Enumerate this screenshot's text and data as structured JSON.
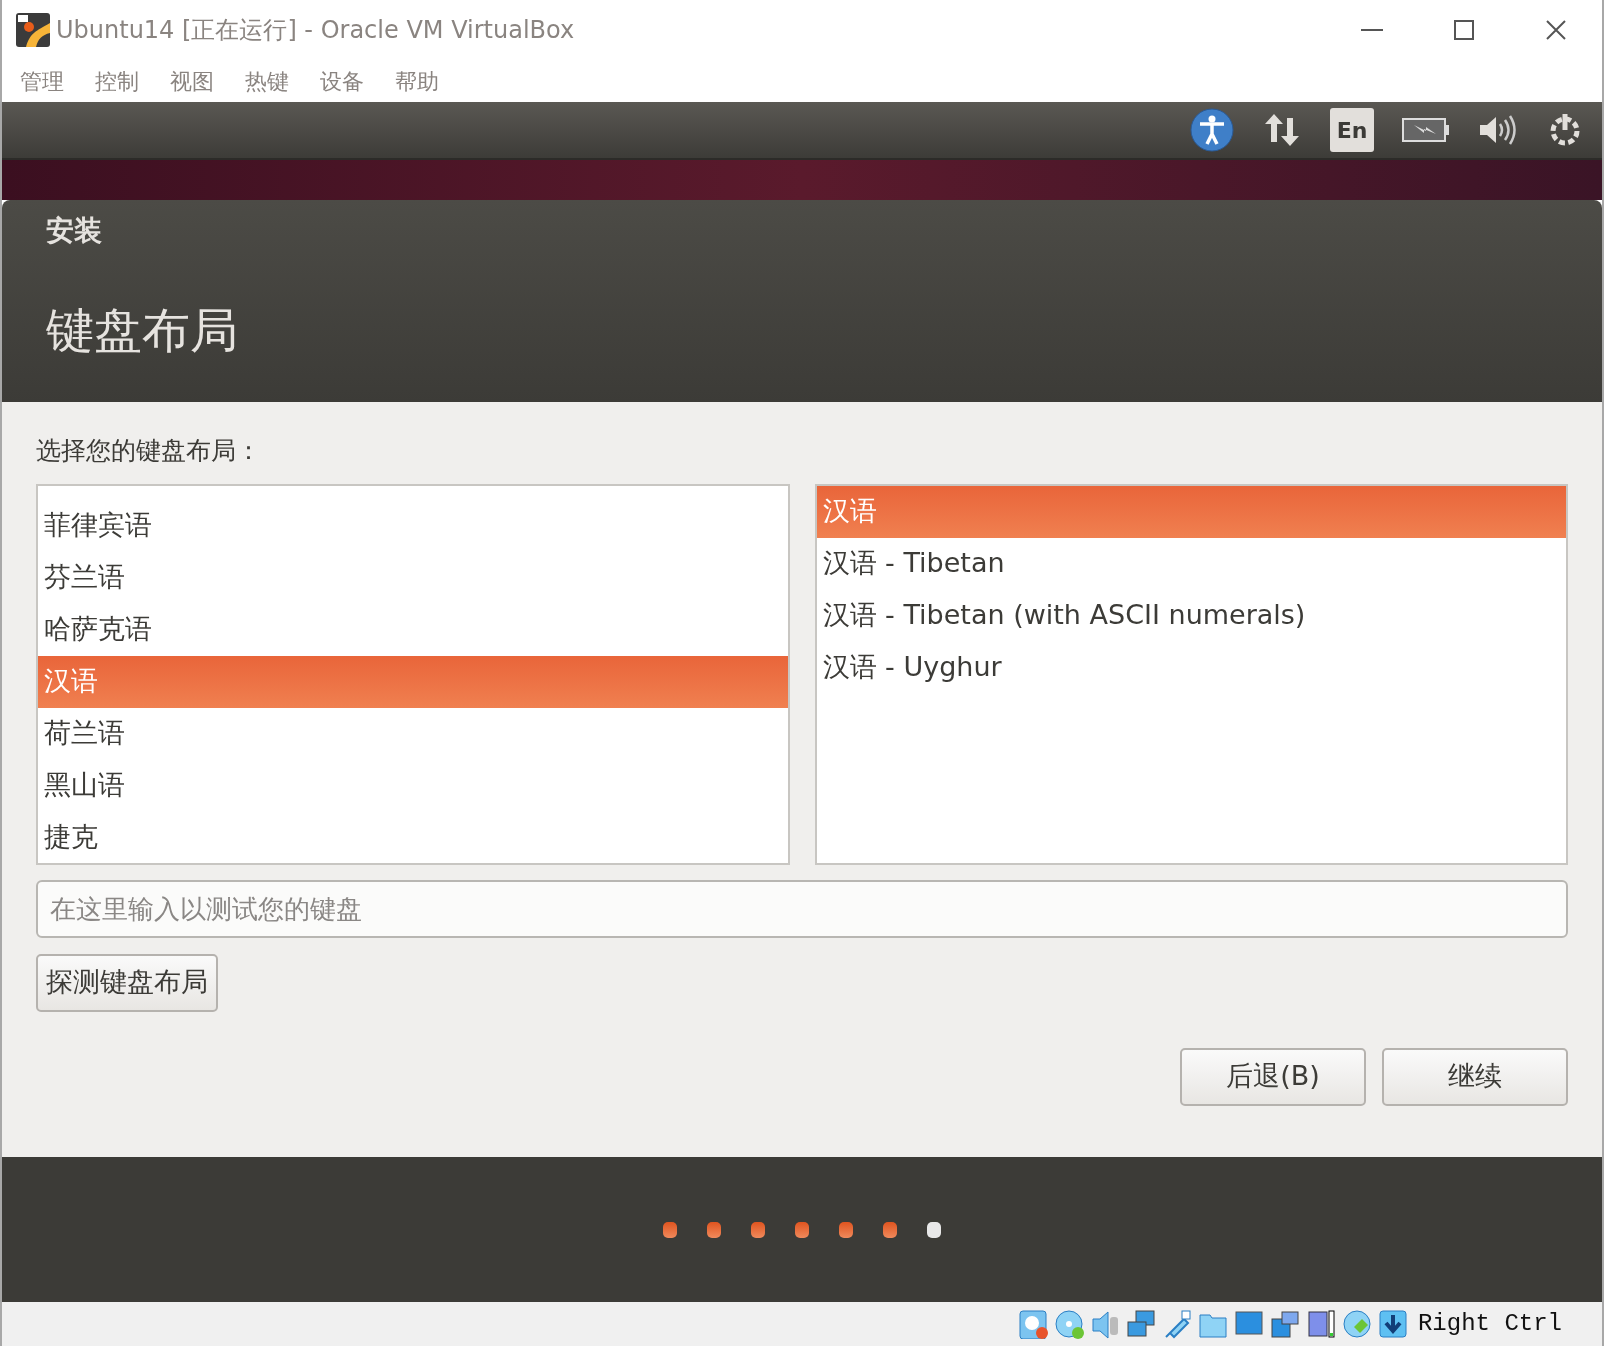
{
  "window": {
    "title": "Ubuntu14 [正在运行] - Oracle VM VirtualBox"
  },
  "menu": [
    "管理",
    "控制",
    "视图",
    "热键",
    "设备",
    "帮助"
  ],
  "top_panel": {
    "keyboard_indicator": "En"
  },
  "installer": {
    "title": "安装",
    "heading": "键盘布局",
    "prompt": "选择您的键盘布局：",
    "layouts": [
      {
        "label": "菲律宾语",
        "selected": false
      },
      {
        "label": "芬兰语",
        "selected": false
      },
      {
        "label": "哈萨克语",
        "selected": false
      },
      {
        "label": "汉语",
        "selected": true
      },
      {
        "label": "荷兰语",
        "selected": false
      },
      {
        "label": "黑山语",
        "selected": false
      },
      {
        "label": "捷克",
        "selected": false
      }
    ],
    "variants": [
      {
        "label": "汉语",
        "selected": true
      },
      {
        "label": "汉语 - Tibetan",
        "selected": false
      },
      {
        "label": "汉语 - Tibetan (with ASCII numerals)",
        "selected": false
      },
      {
        "label": "汉语 - Uyghur",
        "selected": false
      }
    ],
    "test_field": {
      "placeholder": "在这里输入以测试您的键盘"
    },
    "detect_button": "探测键盘布局",
    "back_button": "后退(B)",
    "continue_button": "继续",
    "steps": [
      {
        "done": true
      },
      {
        "done": true
      },
      {
        "done": true
      },
      {
        "done": true
      },
      {
        "done": true
      },
      {
        "done": true
      },
      {
        "done": false
      }
    ]
  },
  "status_bar": {
    "host_key": "Right Ctrl"
  }
}
